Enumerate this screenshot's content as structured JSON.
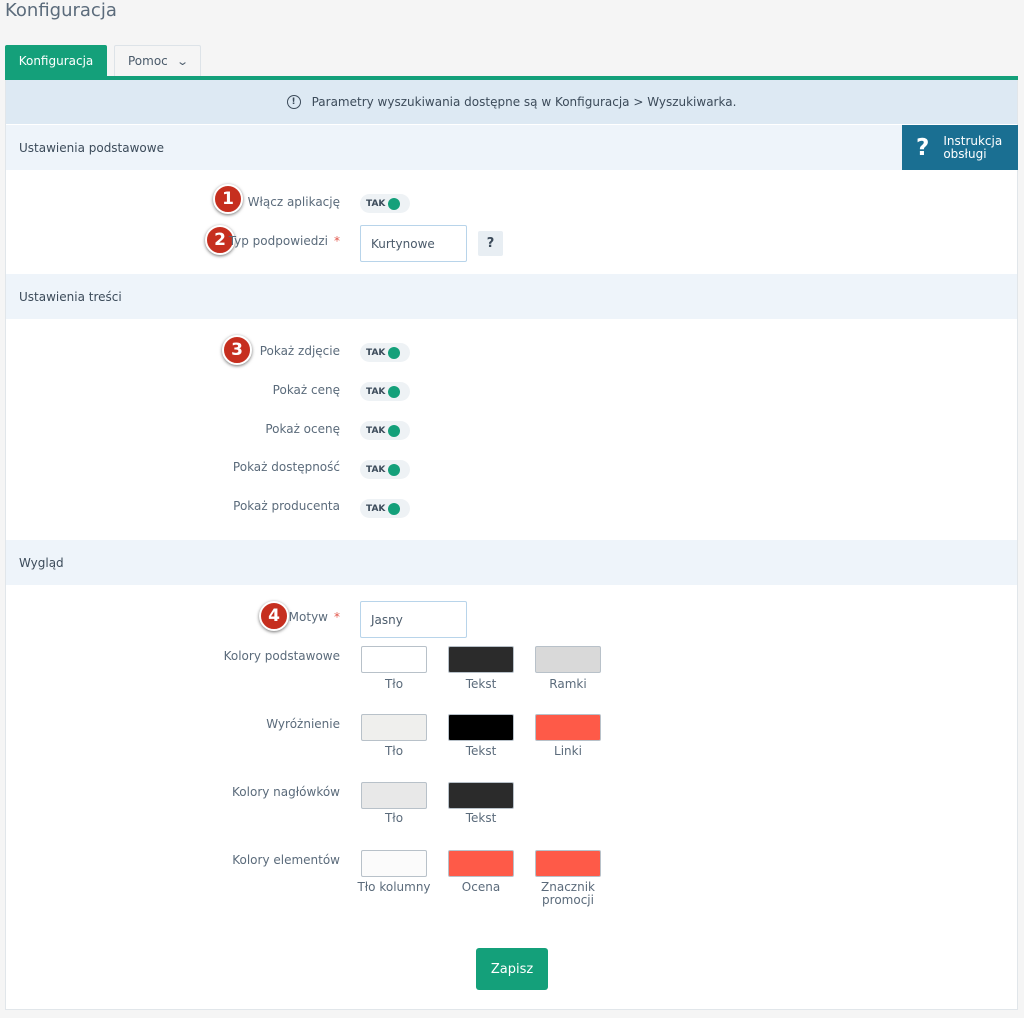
{
  "page_title": "Konfiguracja",
  "tabs": {
    "active_label": "Konfiguracja",
    "help_label": "Pomoc",
    "help_chevron": "⌄"
  },
  "info_banner": {
    "icon": "!",
    "text": "Parametry wyszukiwania dostępne są w Konfiguracja > Wyszukiwarka."
  },
  "manual_button": {
    "icon": "?",
    "label": "Instrukcja obsługi"
  },
  "sections": {
    "basic": {
      "title": "Ustawienia podstawowe",
      "enable_app": {
        "label": "Włącz aplikację",
        "toggle": "TAK",
        "badge": "1"
      },
      "hint_type": {
        "label": "Typ podpowiedzi",
        "required": "*",
        "value": "Kurtynowe",
        "help": "?",
        "badge": "2"
      }
    },
    "content": {
      "title": "Ustawienia treści",
      "items": [
        {
          "label": "Pokaż zdjęcie",
          "toggle": "TAK",
          "badge": "3"
        },
        {
          "label": "Pokaż cenę",
          "toggle": "TAK"
        },
        {
          "label": "Pokaż ocenę",
          "toggle": "TAK"
        },
        {
          "label": "Pokaż dostępność",
          "toggle": "TAK"
        },
        {
          "label": "Pokaż producenta",
          "toggle": "TAK"
        }
      ]
    },
    "appearance": {
      "title": "Wygląd",
      "theme": {
        "label": "Motyw",
        "required": "*",
        "value": "Jasny",
        "badge": "4"
      },
      "color_groups": [
        {
          "label": "Kolory podstawowe",
          "swatches": [
            {
              "label": "Tło",
              "color": "#ffffff"
            },
            {
              "label": "Tekst",
              "color": "#2b2b2b"
            },
            {
              "label": "Ramki",
              "color": "#d9d9d9"
            }
          ]
        },
        {
          "label": "Wyróżnienie",
          "swatches": [
            {
              "label": "Tło",
              "color": "#efefed"
            },
            {
              "label": "Tekst",
              "color": "#000000"
            },
            {
              "label": "Linki",
              "color": "#fe5a48"
            }
          ]
        },
        {
          "label": "Kolory nagłówków",
          "swatches": [
            {
              "label": "Tło",
              "color": "#e8e8e8"
            },
            {
              "label": "Tekst",
              "color": "#2b2b2b"
            }
          ]
        },
        {
          "label": "Kolory elementów",
          "swatches": [
            {
              "label": "Tło kolumny",
              "color": "#fbfbfb"
            },
            {
              "label": "Ocena",
              "color": "#fe5a48"
            },
            {
              "label": "Znacznik promocji",
              "color": "#fe5a48"
            }
          ]
        }
      ]
    }
  },
  "save_label": "Zapisz",
  "colors": {
    "accent": "#14a07a",
    "info_bg": "#dde9f3",
    "section_bg": "#eef4fa",
    "manual_bg": "#1a6f92",
    "badge": "#c62f1f"
  }
}
